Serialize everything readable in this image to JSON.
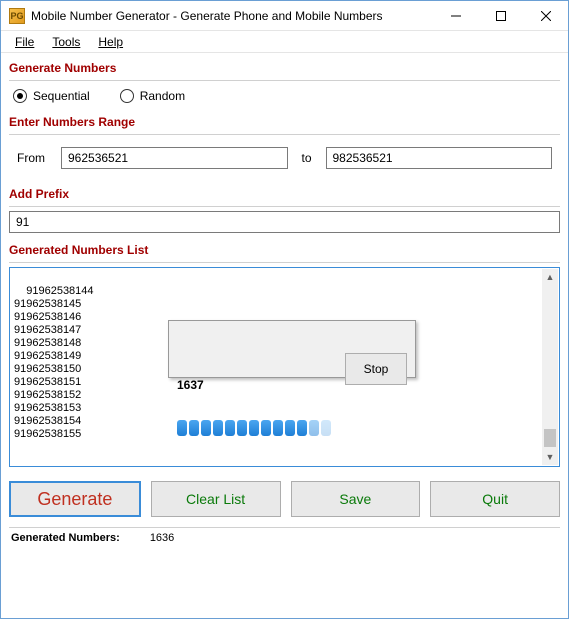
{
  "window": {
    "title": "Mobile Number Generator - Generate Phone and Mobile Numbers",
    "icon_text": "PG"
  },
  "menu": {
    "file": "File",
    "tools": "Tools",
    "help": "Help"
  },
  "sections": {
    "generate_numbers": "Generate Numbers",
    "enter_range": "Enter Numbers Range",
    "add_prefix": "Add Prefix",
    "generated_list": "Generated Numbers List"
  },
  "radios": {
    "sequential": "Sequential",
    "random": "Random",
    "selected": "sequential"
  },
  "range": {
    "from_label": "From",
    "to_label": "to",
    "from_value": "962536521",
    "to_value": "982536521"
  },
  "prefix": {
    "value": "91"
  },
  "numbers_list": "91962538144\n91962538145\n91962538146\n91962538147\n91962538148\n91962538149\n91962538150\n91962538151\n91962538152\n91962538153\n91962538154\n91962538155",
  "progress": {
    "count": "1637",
    "stop_label": "Stop"
  },
  "buttons": {
    "generate": "Generate",
    "clear_list": "Clear List",
    "save": "Save",
    "quit": "Quit"
  },
  "status": {
    "label": "Generated Numbers:",
    "value": "1636"
  }
}
